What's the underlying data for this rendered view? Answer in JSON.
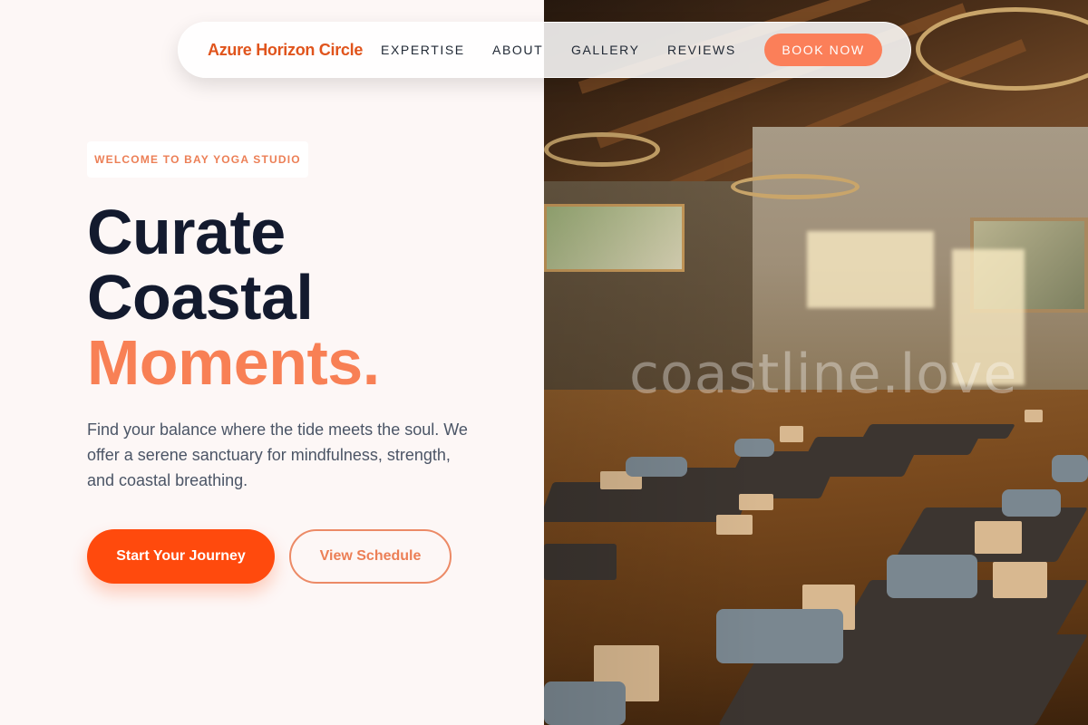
{
  "nav": {
    "brand": "Azure Horizon Circle",
    "links": [
      "EXPERTISE",
      "ABOUT",
      "GALLERY",
      "REVIEWS"
    ],
    "cta": "BOOK NOW"
  },
  "hero": {
    "eyebrow": "WELCOME TO BAY YOGA STUDIO",
    "headline_line1": "Curate",
    "headline_line2": "Coastal",
    "headline_accent": "Moments.",
    "lead": "Find your balance where the tide meets the soul. We offer a serene sanctuary for mindfulness, strength, and coastal breathing.",
    "primary_cta": "Start Your Journey",
    "secondary_cta": "View Schedule"
  },
  "image": {
    "watermark": "coastline.love"
  },
  "colors": {
    "accent": "#ff4a0d",
    "accent_soft": "#f88055",
    "heading": "#131a2e",
    "body": "#4b5566"
  }
}
